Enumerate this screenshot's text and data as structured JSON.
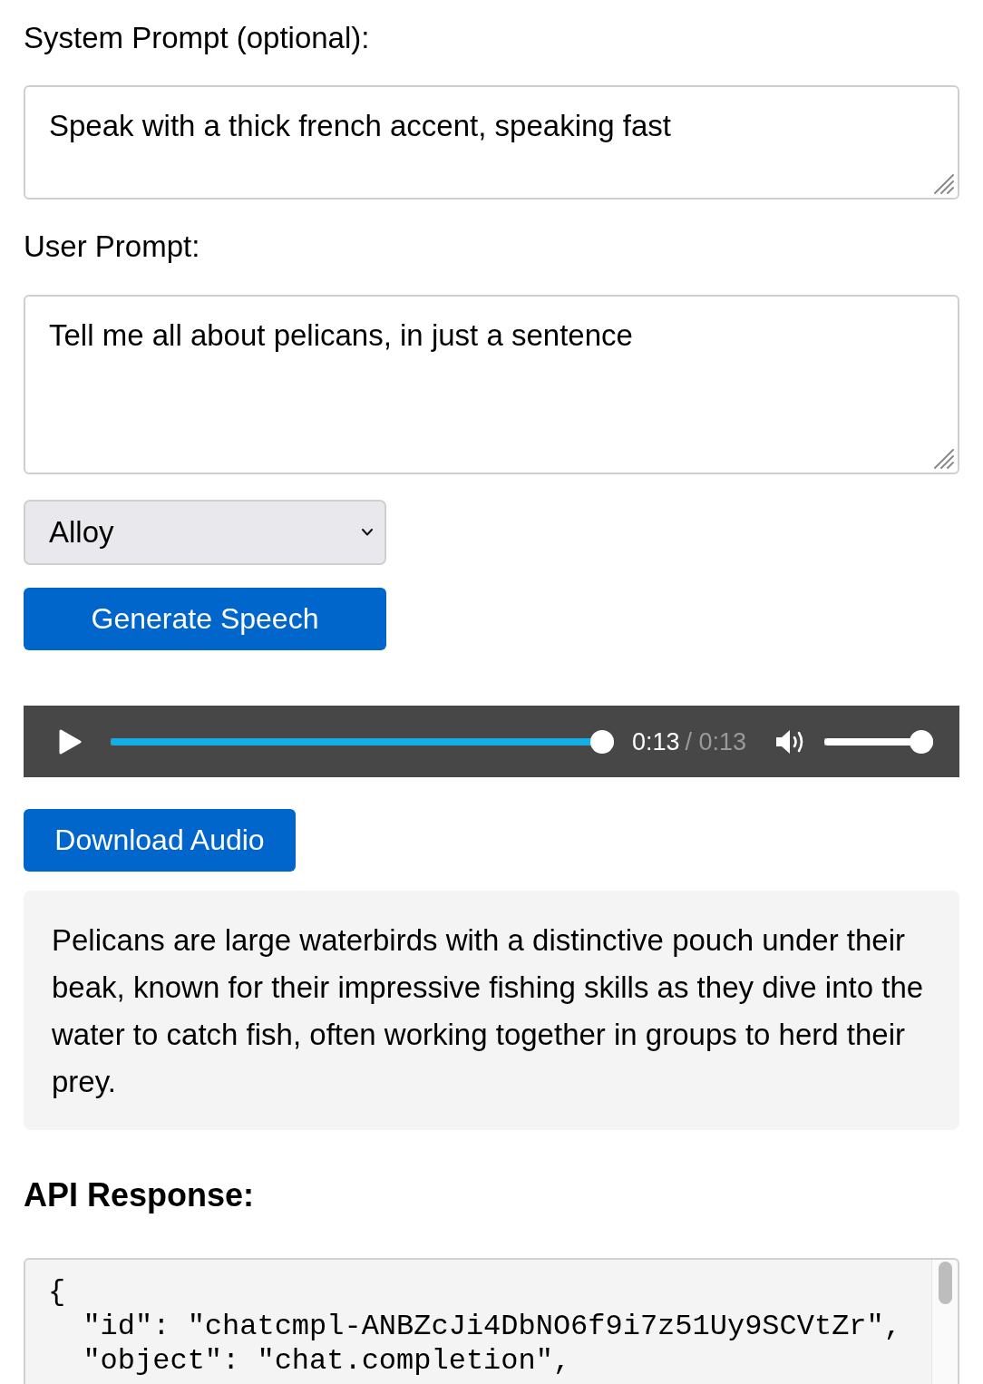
{
  "system_prompt": {
    "label": "System Prompt (optional):",
    "value": "Speak with a thick french accent, speaking fast"
  },
  "user_prompt": {
    "label": "User Prompt:",
    "value": "Tell me all about pelicans, in just a sentence"
  },
  "voice_select": {
    "value": "Alloy"
  },
  "generate_button": {
    "label": "Generate Speech"
  },
  "audio_player": {
    "playing": false,
    "seek": {
      "level": 1
    },
    "current_time": "0:13",
    "total_time": "/ 0:13",
    "muted": false,
    "volume": {
      "level": 1
    }
  },
  "download_button": {
    "label": "Download Audio"
  },
  "response_text": "Pelicans are large waterbirds with a distinctive pouch under their beak, known for their impressive fishing skills as they dive into the water to catch fish, often working together in groups to herd their prey.",
  "api_response": {
    "heading": "API Response:",
    "code_lines": [
      "{",
      "  \"id\": \"chatcmpl-ANBZcJi4DbNO6f9i7z51Uy9SCVtZr\",",
      "  \"object\": \"chat.completion\","
    ]
  }
}
